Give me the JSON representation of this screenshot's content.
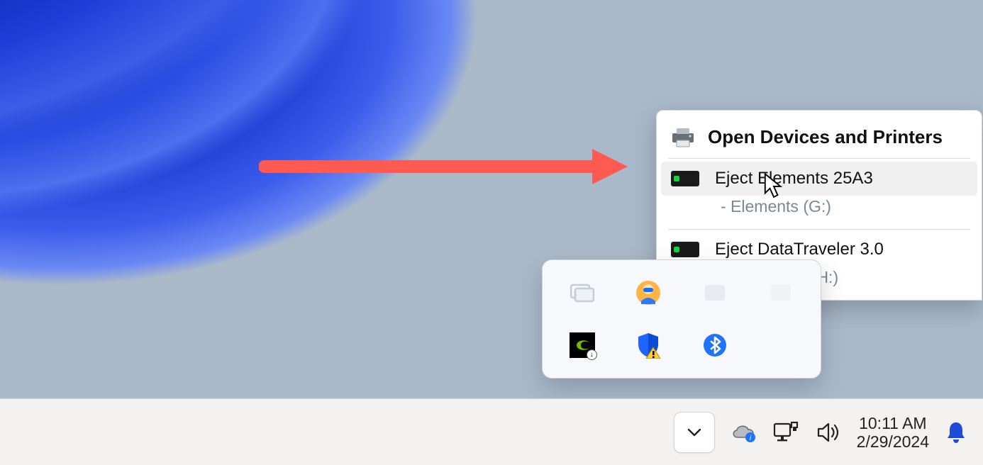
{
  "eject_menu": {
    "header": "Open Devices and Printers",
    "devices": [
      {
        "eject_label": "Eject Elements 25A3",
        "volume_label": "-   Elements (G:)"
      },
      {
        "eject_label": "Eject DataTraveler 3.0",
        "volume_label": "-   USB Drive (H:)"
      }
    ]
  },
  "overflow_tray": {
    "icons": [
      "task-view-icon",
      "avatar-app-icon",
      "hidden-app-icon-a",
      "hidden-app-icon-b",
      "nvidia-icon",
      "defender-warning-icon",
      "bluetooth-icon"
    ]
  },
  "taskbar": {
    "chevron_label": "Show hidden icons",
    "time": "10:11 AM",
    "date": "2/29/2024"
  },
  "annotation": {
    "arrow_color": "#ff5a52"
  }
}
